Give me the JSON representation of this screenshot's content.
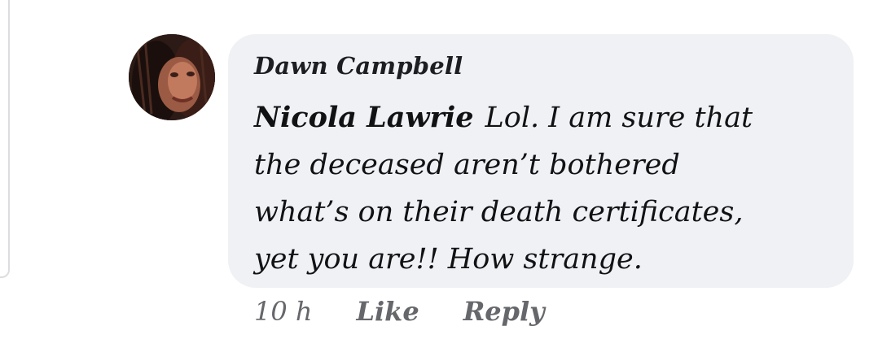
{
  "comment": {
    "author": "Dawn Campbell",
    "mention": "Nicola Lawrie",
    "lines": [
      "Lol. I am sure that",
      "the deceased aren’t bothered",
      "what’s on their death certificates,",
      "yet you are!! How strange."
    ],
    "avatar_icon": "profile-photo"
  },
  "actions": {
    "time": "10 h",
    "like": "Like",
    "reply": "Reply"
  },
  "colors": {
    "bubble_bg": "#f0f1f4",
    "text": "#111214",
    "muted": "#65676b"
  }
}
